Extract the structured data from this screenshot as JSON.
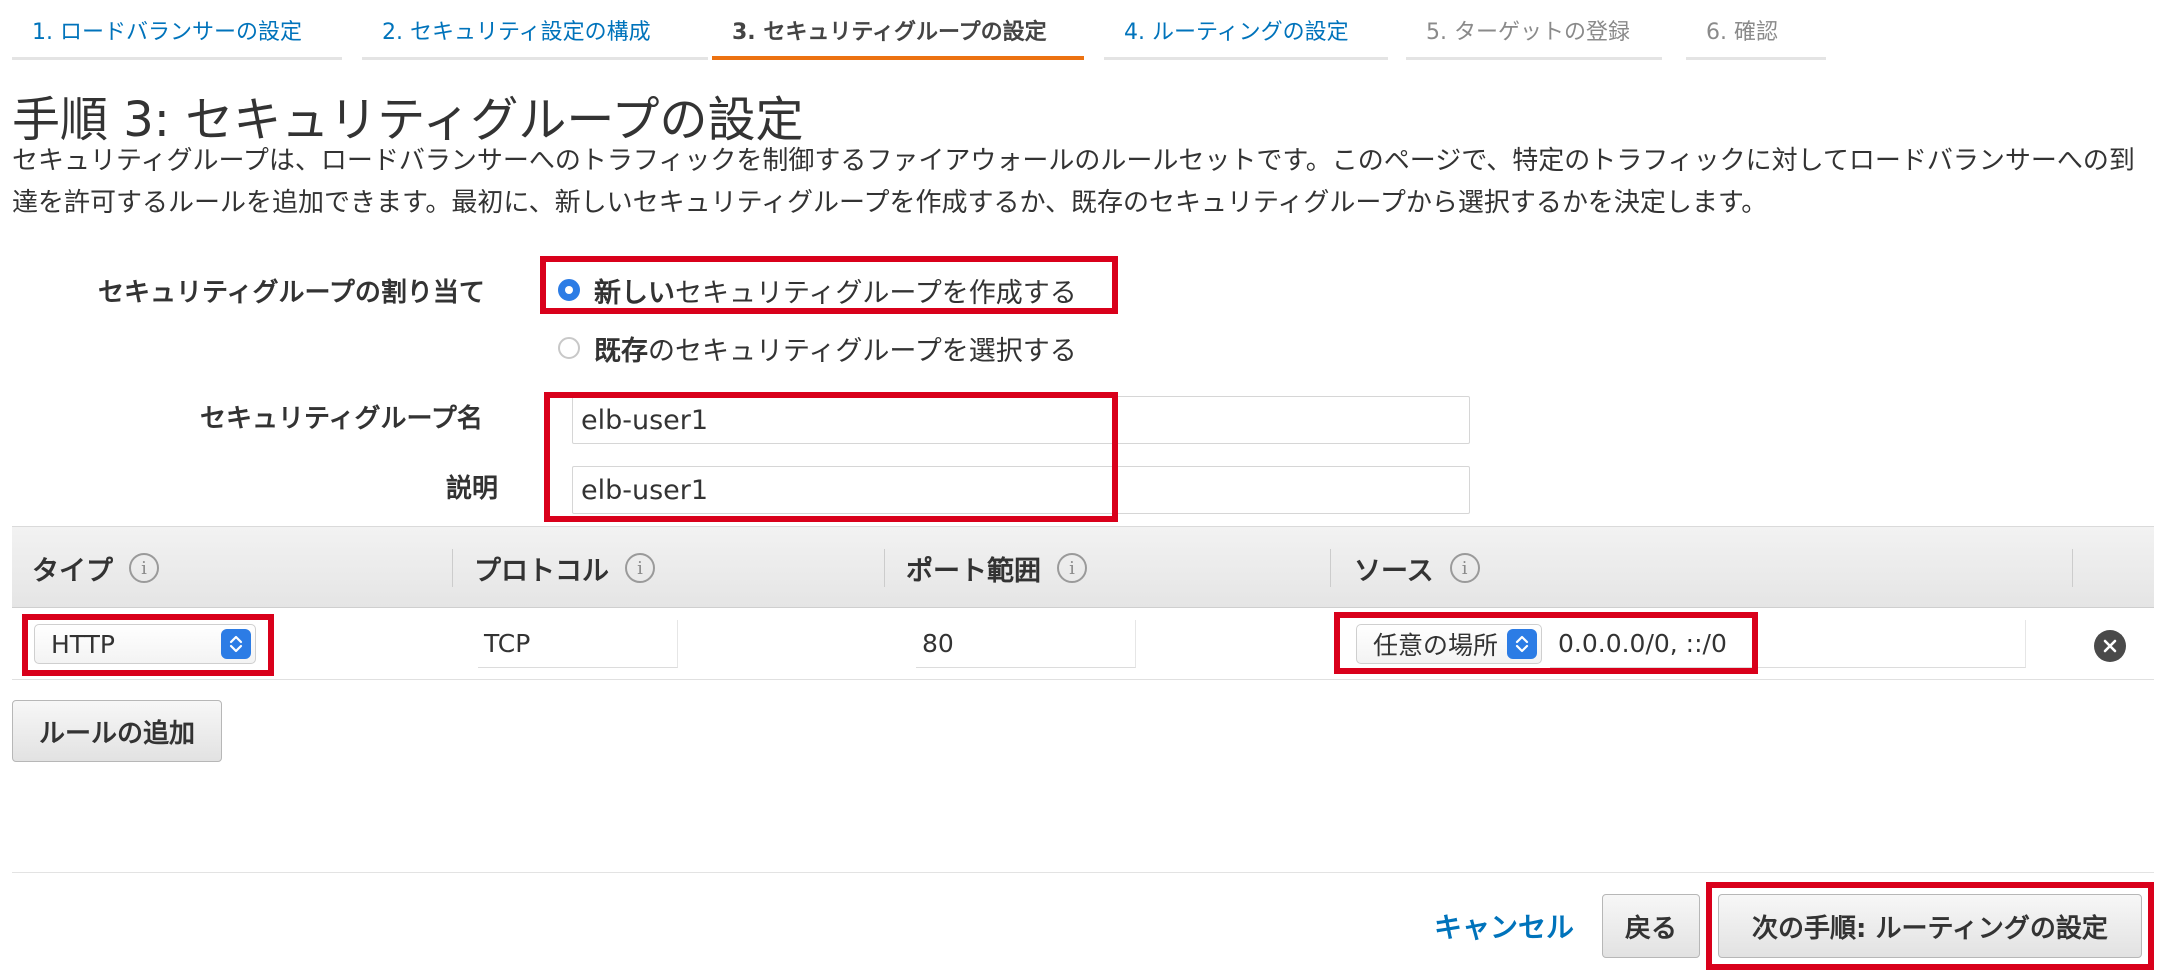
{
  "wizard": {
    "steps": [
      {
        "label": "1. ロードバランサーの設定"
      },
      {
        "label": "2. セキュリティ設定の構成"
      },
      {
        "label": "3. セキュリティグループの設定"
      },
      {
        "label": "4. ルーティングの設定"
      },
      {
        "label": "5. ターゲットの登録"
      },
      {
        "label": "6. 確認"
      }
    ],
    "active_step": 3
  },
  "page": {
    "title": "手順 3: セキュリティグループの設定",
    "description": "セキュリティグループは、ロードバランサーへのトラフィックを制御するファイアウォールのルールセットです。このページで、特定のトラフィックに対してロードバランサーへの到達を許可するルールを追加できます。最初に、新しいセキュリティグループを作成するか、既存のセキュリティグループから選択するかを決定します。"
  },
  "form": {
    "assign_label": "セキュリティグループの割り当て",
    "option_new_bold": "新しい",
    "option_new_rest": "セキュリティグループを作成する",
    "option_existing_bold": "既存",
    "option_existing_rest": "のセキュリティグループを選択する",
    "selected_option": "new",
    "name_label": "セキュリティグループ名",
    "name_value": "elb-user1",
    "description_label": "説明",
    "description_value": "elb-user1"
  },
  "rules_table": {
    "columns": [
      {
        "label": "タイプ",
        "icon": "info-icon"
      },
      {
        "label": "プロトコル",
        "icon": "info-icon"
      },
      {
        "label": "ポート範囲",
        "icon": "info-icon"
      },
      {
        "label": "ソース",
        "icon": "info-icon"
      }
    ],
    "rows": [
      {
        "type": "HTTP",
        "protocol": "TCP",
        "port_range": "80",
        "source_select": "任意の場所",
        "source_cidr": "0.0.0.0/0, ::/0"
      }
    ],
    "add_rule_label": "ルールの追加"
  },
  "footer": {
    "cancel_label": "キャンセル",
    "back_label": "戻る",
    "next_label": "次の手順: ルーティングの設定"
  },
  "colors": {
    "link": "#0073bb",
    "active_tab_underline": "#ec7211",
    "highlight_box": "#d9001b",
    "select_accent": "#2c7ce5"
  }
}
